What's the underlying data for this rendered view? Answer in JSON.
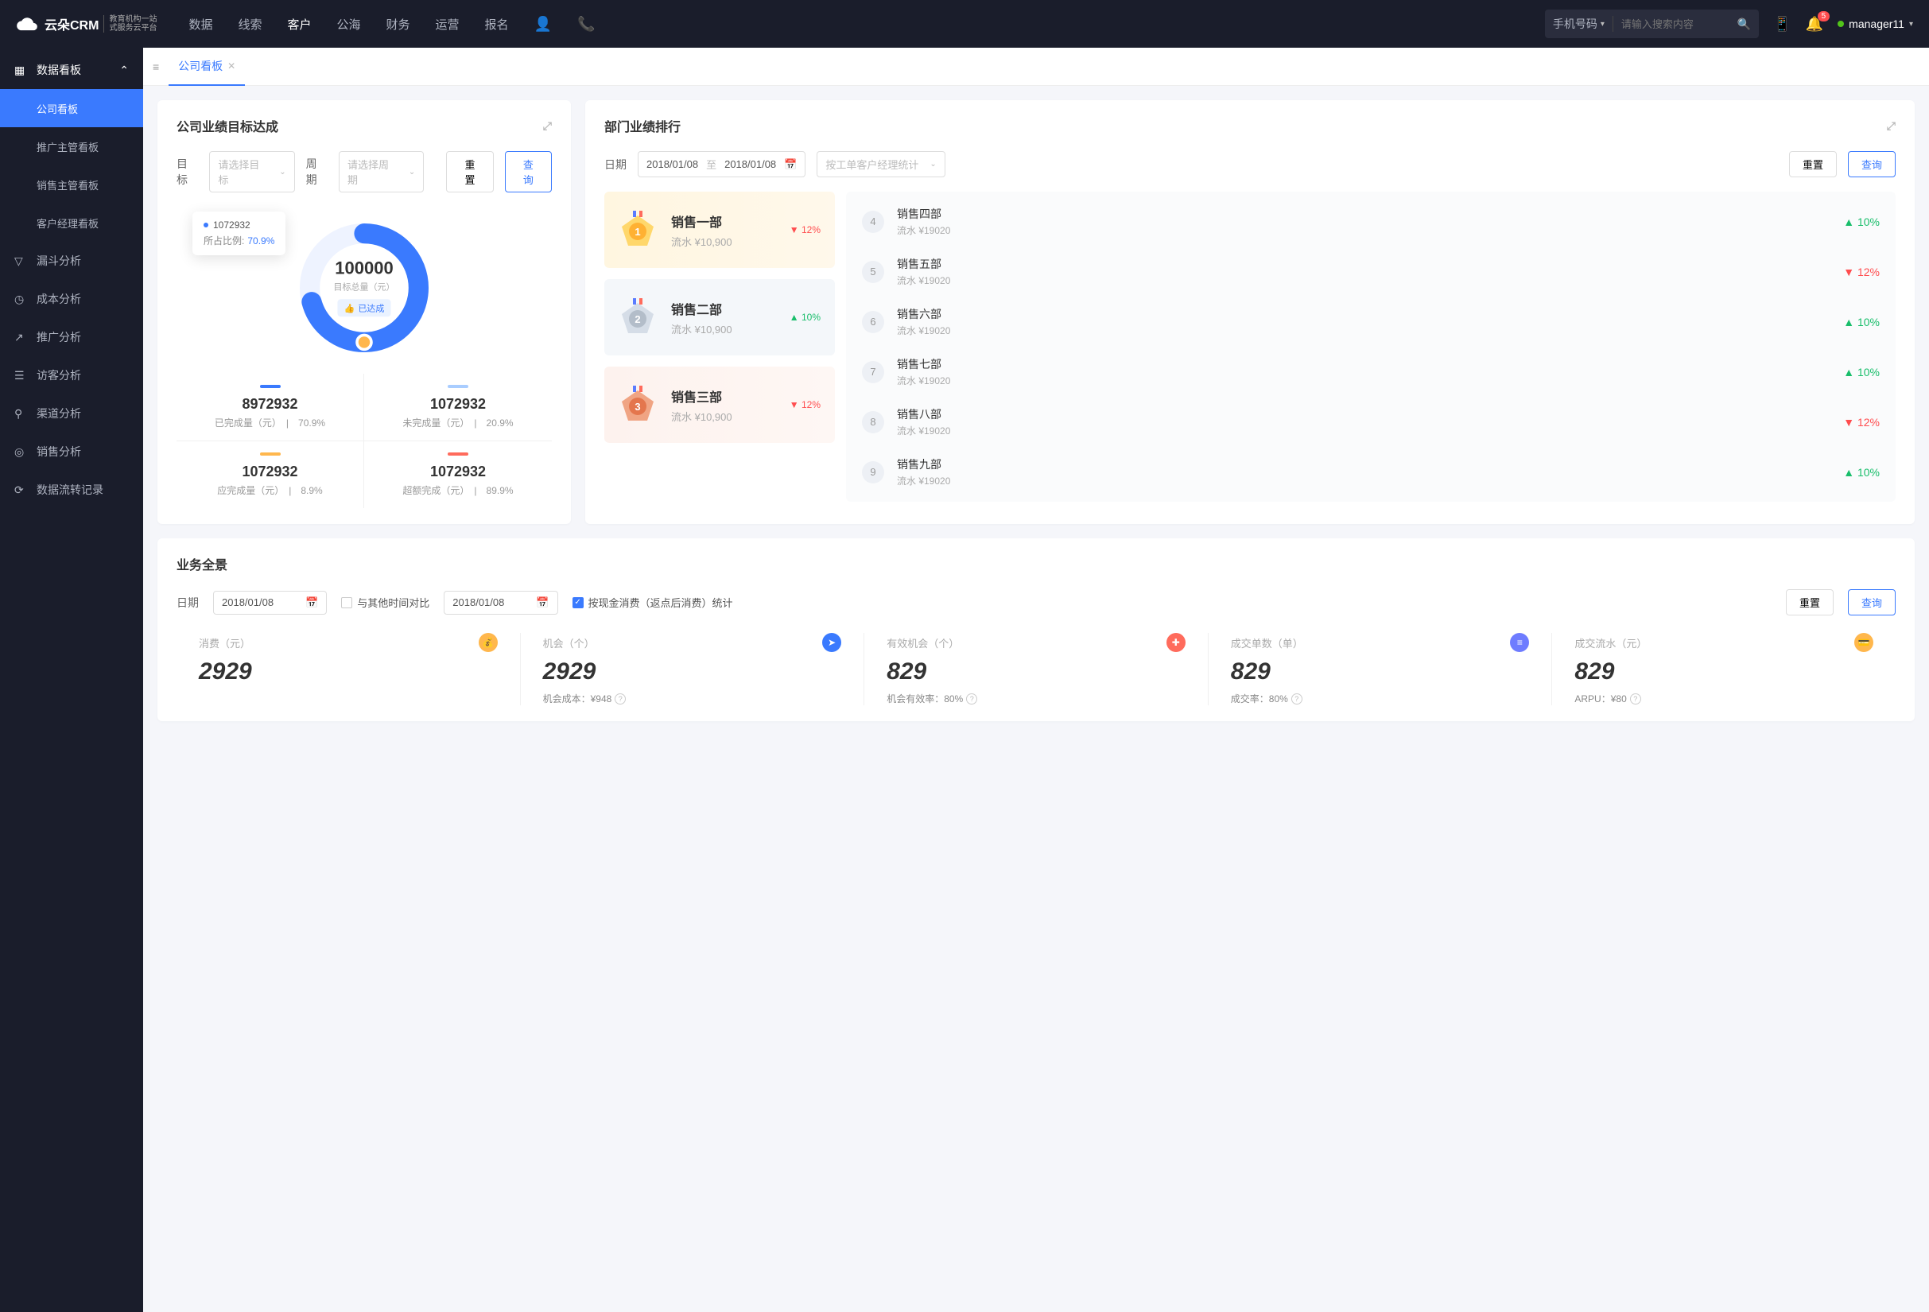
{
  "brand": {
    "name": "云朵CRM",
    "sub1": "教育机构一站",
    "sub2": "式服务云平台"
  },
  "topnav": {
    "items": [
      "数据",
      "线索",
      "客户",
      "公海",
      "财务",
      "运营",
      "报名"
    ],
    "active": 2
  },
  "search": {
    "type": "手机号码",
    "placeholder": "请输入搜索内容"
  },
  "notif_count": "5",
  "user": "manager11",
  "sidebar": {
    "head": "数据看板",
    "subs": [
      "公司看板",
      "推广主管看板",
      "销售主管看板",
      "客户经理看板"
    ],
    "active_sub": 0,
    "items": [
      {
        "label": "漏斗分析"
      },
      {
        "label": "成本分析"
      },
      {
        "label": "推广分析"
      },
      {
        "label": "访客分析"
      },
      {
        "label": "渠道分析"
      },
      {
        "label": "销售分析"
      },
      {
        "label": "数据流转记录"
      }
    ]
  },
  "tab": {
    "name": "公司看板"
  },
  "goal": {
    "title": "公司业绩目标达成",
    "lbl_target": "目标",
    "sel_target": "请选择目标",
    "lbl_period": "周期",
    "sel_period": "请选择周期",
    "btn_reset": "重置",
    "btn_query": "查询",
    "total": "100000",
    "total_label": "目标总量（元）",
    "status": "已达成",
    "tooltip_value": "1072932",
    "tooltip_label": "所占比例:",
    "tooltip_pct": "70.9%",
    "stats": [
      {
        "color": "#3a7afe",
        "value": "8972932",
        "label": "已完成量（元）",
        "pct": "70.9%"
      },
      {
        "color": "#a9cdff",
        "value": "1072932",
        "label": "未完成量（元）",
        "pct": "20.9%"
      },
      {
        "color": "#ffb74d",
        "value": "1072932",
        "label": "应完成量（元）",
        "pct": "8.9%"
      },
      {
        "color": "#ff6b5c",
        "value": "1072932",
        "label": "超额完成（元）",
        "pct": "89.9%"
      }
    ]
  },
  "rank": {
    "title": "部门业绩排行",
    "lbl_date": "日期",
    "date_from": "2018/01/08",
    "date_to": "2018/01/08",
    "date_sep": "至",
    "select": "按工单客户经理统计",
    "btn_reset": "重置",
    "btn_query": "查询",
    "top3": [
      {
        "name": "销售一部",
        "flow": "流水 ¥10,900",
        "pct": "12%",
        "dir": "down"
      },
      {
        "name": "销售二部",
        "flow": "流水 ¥10,900",
        "pct": "10%",
        "dir": "up"
      },
      {
        "name": "销售三部",
        "flow": "流水 ¥10,900",
        "pct": "12%",
        "dir": "down"
      }
    ],
    "rest": [
      {
        "n": "4",
        "name": "销售四部",
        "flow": "流水 ¥19020",
        "pct": "10%",
        "dir": "up"
      },
      {
        "n": "5",
        "name": "销售五部",
        "flow": "流水 ¥19020",
        "pct": "12%",
        "dir": "down"
      },
      {
        "n": "6",
        "name": "销售六部",
        "flow": "流水 ¥19020",
        "pct": "10%",
        "dir": "up"
      },
      {
        "n": "7",
        "name": "销售七部",
        "flow": "流水 ¥19020",
        "pct": "10%",
        "dir": "up"
      },
      {
        "n": "8",
        "name": "销售八部",
        "flow": "流水 ¥19020",
        "pct": "12%",
        "dir": "down"
      },
      {
        "n": "9",
        "name": "销售九部",
        "flow": "流水 ¥19020",
        "pct": "10%",
        "dir": "up"
      }
    ]
  },
  "overview": {
    "title": "业务全景",
    "lbl_date": "日期",
    "date1": "2018/01/08",
    "compare_label": "与其他时间对比",
    "date2": "2018/01/08",
    "check_label": "按现金消费（返点后消费）统计",
    "btn_reset": "重置",
    "btn_query": "查询",
    "kpis": [
      {
        "label": "消费（元）",
        "value": "2929",
        "icon": "💰",
        "icon_bg": "#ffb74d",
        "foot": ""
      },
      {
        "label": "机会（个）",
        "value": "2929",
        "icon": "➤",
        "icon_bg": "#3a7afe",
        "foot": "机会成本：¥948"
      },
      {
        "label": "有效机会（个）",
        "value": "829",
        "icon": "✚",
        "icon_bg": "#ff6b5c",
        "foot": "机会有效率：80%"
      },
      {
        "label": "成交单数（单）",
        "value": "829",
        "icon": "≡",
        "icon_bg": "#6e7cff",
        "foot": "成交率：80%"
      },
      {
        "label": "成交流水（元）",
        "value": "829",
        "icon": "💳",
        "icon_bg": "#ffb74d",
        "foot": "ARPU：¥80"
      }
    ]
  },
  "chart_data": {
    "type": "pie",
    "title": "目标达成",
    "total": 100000,
    "series": [
      {
        "name": "已完成量",
        "value": 8972932,
        "percent": 70.9,
        "color": "#3a7afe"
      },
      {
        "name": "未完成量",
        "value": 1072932,
        "percent": 20.9,
        "color": "#a9cdff"
      },
      {
        "name": "应完成量",
        "value": 1072932,
        "percent": 8.9,
        "color": "#ffb74d"
      },
      {
        "name": "超额完成",
        "value": 1072932,
        "percent": 89.9,
        "color": "#ff6b5c"
      }
    ]
  }
}
